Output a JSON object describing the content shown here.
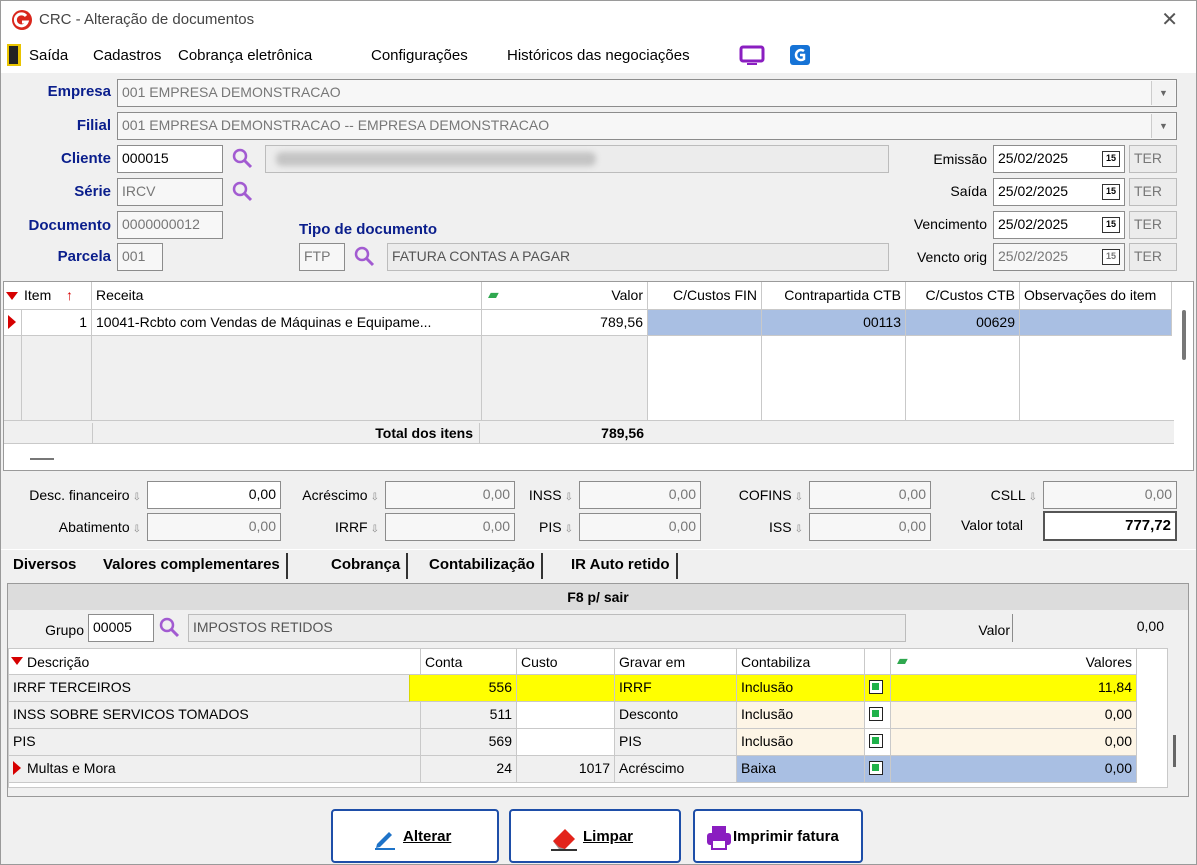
{
  "window": {
    "title": "CRC - Alteração de documentos"
  },
  "menu": [
    "Saída",
    "Cadastros",
    "Cobrança eletrônica",
    "Configurações",
    "Históricos das negociações"
  ],
  "header": {
    "empresa_label": "Empresa",
    "empresa_value": "001 EMPRESA DEMONSTRACAO",
    "filial_label": "Filial",
    "filial_value": "001 EMPRESA DEMONSTRACAO -- EMPRESA DEMONSTRACAO",
    "cliente_label": "Cliente",
    "cliente_value": "000015",
    "serie_label": "Série",
    "serie_value": "IRCV",
    "documento_label": "Documento",
    "documento_value": "0000000012",
    "parcela_label": "Parcela",
    "parcela_value": "001",
    "tipo_label": "Tipo de documento",
    "tipo_code": "FTP",
    "tipo_desc": "FATURA CONTAS A PAGAR"
  },
  "dates": [
    {
      "label": "Emissão",
      "value": "25/02/2025",
      "day": "TER"
    },
    {
      "label": "Saída",
      "value": "25/02/2025",
      "day": "TER"
    },
    {
      "label": "Vencimento",
      "value": "25/02/2025",
      "day": "TER"
    },
    {
      "label": "Vencto orig",
      "value": "25/02/2025",
      "day": "TER"
    }
  ],
  "items_grid": {
    "headers": [
      "Item",
      "Receita",
      "Valor",
      "C/Custos FIN",
      "Contrapartida CTB",
      "C/Custos CTB",
      "Observações do item"
    ],
    "row": {
      "item": "1",
      "receita": "10041-Rcbto com Vendas de Máquinas e Equipame...",
      "valor": "789,56",
      "ccfin": "",
      "contra": "00113",
      "ccctb": "00629",
      "obs": ""
    },
    "total_label": "Total dos itens",
    "total_value": "789,56"
  },
  "totals": {
    "desc_fin_label": "Desc. financeiro",
    "desc_fin": "0,00",
    "acrescimo_label": "Acréscimo",
    "acrescimo": "0,00",
    "inss_label": "INSS",
    "inss": "0,00",
    "cofins_label": "COFINS",
    "cofins": "0,00",
    "csll_label": "CSLL",
    "csll": "0,00",
    "abatimento_label": "Abatimento",
    "abatimento": "0,00",
    "irrf_label": "IRRF",
    "irrf": "0,00",
    "pis_label": "PIS",
    "pis": "0,00",
    "iss_label": "ISS",
    "iss": "0,00",
    "valor_total_label": "Valor total",
    "valor_total": "777,72"
  },
  "tabs": [
    "Diversos",
    "Valores complementares",
    "Cobrança",
    "Contabilização",
    "IR Auto retido"
  ],
  "panel": {
    "caption": "F8 p/ sair",
    "grupo_label": "Grupo",
    "grupo_code": "00005",
    "grupo_desc": "IMPOSTOS RETIDOS",
    "valor_label": "Valor",
    "valor": "0,00",
    "headers": [
      "Descrição",
      "Conta",
      "Custo",
      "Gravar em",
      "Contabiliza",
      "Valores"
    ],
    "rows": [
      {
        "desc": "IRRF TERCEIROS",
        "conta": "556",
        "custo": "",
        "gravar": "IRRF",
        "contab": "Inclusão",
        "valor": "11,84"
      },
      {
        "desc": "INSS SOBRE SERVICOS TOMADOS",
        "conta": "511",
        "custo": "",
        "gravar": "Desconto",
        "contab": "Inclusão",
        "valor": "0,00"
      },
      {
        "desc": "PIS",
        "conta": "569",
        "custo": "",
        "gravar": "PIS",
        "contab": "Inclusão",
        "valor": "0,00"
      },
      {
        "desc": "Multas e Mora",
        "conta": "24",
        "custo": "1017",
        "gravar": "Acréscimo",
        "contab": "Baixa",
        "valor": "0,00"
      }
    ]
  },
  "buttons": {
    "alterar": "Alterar",
    "limpar": "Limpar",
    "imprimir": "Imprimir fatura"
  },
  "colors": {
    "label_blue": "#0a1e8c",
    "selection": "#a9bfe3",
    "highlight": "#ffff00",
    "brand_red": "#d9261c"
  }
}
